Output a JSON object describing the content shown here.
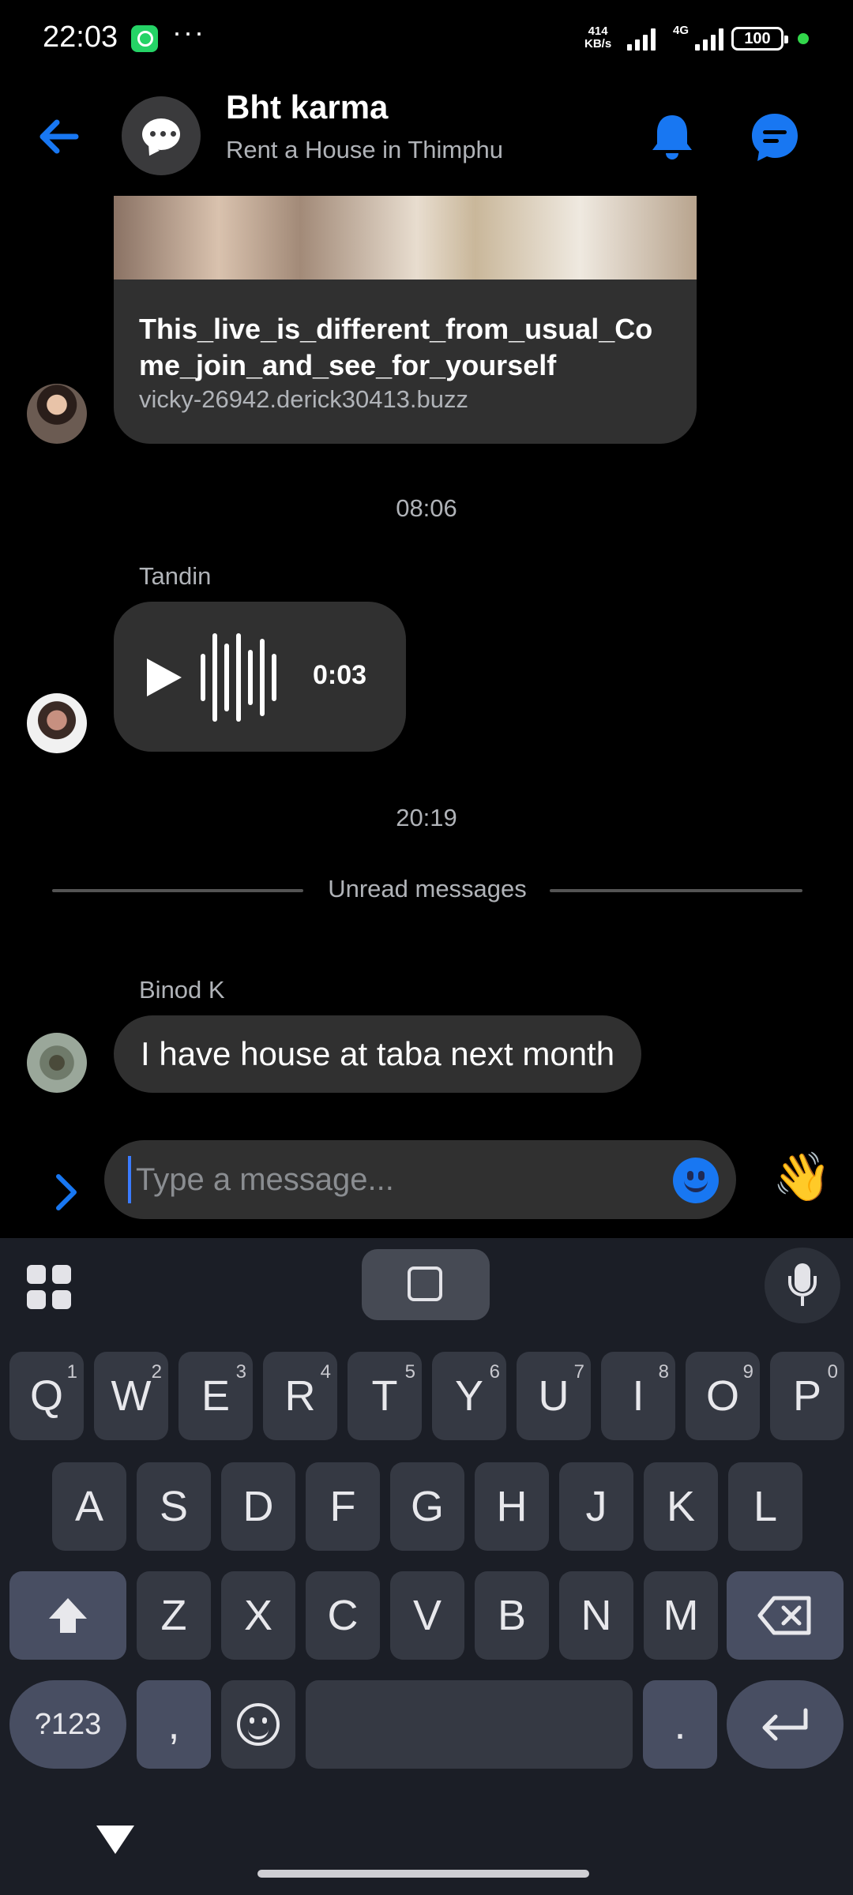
{
  "status_bar": {
    "time": "22:03",
    "more": "···",
    "net_speed_value": "414",
    "net_speed_unit": "KB/s",
    "network_type": "4G",
    "battery": "100"
  },
  "header": {
    "title": "Bht karma",
    "subtitle": "Rent a House in Thimphu",
    "accent_color": "#1877f2"
  },
  "messages": {
    "link_card": {
      "title": "This_live_is_different_from_usual_Come_join_and_see_for_yourself",
      "url": "vicky-26942.derick30413.buzz"
    },
    "timestamp_1": "08:06",
    "voice_sender": "Tandin",
    "voice_duration": "0:03",
    "timestamp_2": "20:19",
    "unread_divider": "Unread messages",
    "text_sender": "Binod K",
    "text_message": "I have house at taba next month"
  },
  "composer": {
    "placeholder": "Type a message...",
    "wave_emoji": "👋"
  },
  "keyboard": {
    "row1": [
      {
        "k": "Q",
        "n": "1"
      },
      {
        "k": "W",
        "n": "2"
      },
      {
        "k": "E",
        "n": "3"
      },
      {
        "k": "R",
        "n": "4"
      },
      {
        "k": "T",
        "n": "5"
      },
      {
        "k": "Y",
        "n": "6"
      },
      {
        "k": "U",
        "n": "7"
      },
      {
        "k": "I",
        "n": "8"
      },
      {
        "k": "O",
        "n": "9"
      },
      {
        "k": "P",
        "n": "0"
      }
    ],
    "row2": [
      "A",
      "S",
      "D",
      "F",
      "G",
      "H",
      "J",
      "K",
      "L"
    ],
    "row3": [
      "Z",
      "X",
      "C",
      "V",
      "B",
      "N",
      "M"
    ],
    "symbols_key": "?123",
    "comma_key": ",",
    "period_key": "."
  }
}
